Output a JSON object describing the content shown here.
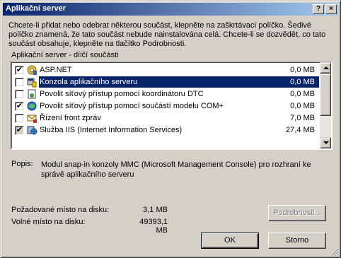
{
  "window": {
    "title": "Aplikační server",
    "description": "Chcete-li přidat nebo odebrat některou součást, klepněte na zaškrtávací políčko. Šedivé políčko znamená, že tato součást nebude nainstalována celá. Chcete-li se dozvědět, co tato součást obsahuje, klepněte na tlačítko Podrobnosti."
  },
  "list": {
    "label": "Aplikační server - dílčí součásti",
    "items": [
      {
        "name": "ASP.NET",
        "size": "0,0 MB",
        "checked": true,
        "icon": "asp-net-icon"
      },
      {
        "name": "Konzola aplikačního serveru",
        "size": "0,0 MB",
        "checked": false,
        "selected": true,
        "icon": "console-icon"
      },
      {
        "name": "Povolit síťový přístup pomocí koordinátoru DTC",
        "size": "0,0 MB",
        "checked": false,
        "icon": "dtc-icon"
      },
      {
        "name": "Povolit síťový přístup pomocí součástí modelu COM+",
        "size": "0,0 MB",
        "checked": true,
        "icon": "com-plus-icon"
      },
      {
        "name": "Řízení front zpráv",
        "size": "7,0 MB",
        "checked": false,
        "icon": "message-queue-icon"
      },
      {
        "name": "Služba IIS (Internet Information Services)",
        "size": "27,4 MB",
        "checked": true,
        "icon": "iis-icon"
      }
    ]
  },
  "popis": {
    "label": "Popis:",
    "text": "Modul snap-in konzoly MMC (Microsoft Management Console) pro rozhraní ke správě aplikačního serveru"
  },
  "disk": {
    "required_label": "Požadované místo na disku:",
    "required_value": "3,1 MB",
    "free_label": "Volné místo na disku:",
    "free_value": "49393,1 MB"
  },
  "buttons": {
    "details": "Podrobnosti...",
    "ok": "OK",
    "cancel": "Storno",
    "help": "?",
    "close": "×"
  },
  "colors": {
    "titlebar_start": "#0a246a",
    "titlebar_end": "#a6caf0",
    "face": "#d4d0c8",
    "selection": "#0a246a"
  }
}
